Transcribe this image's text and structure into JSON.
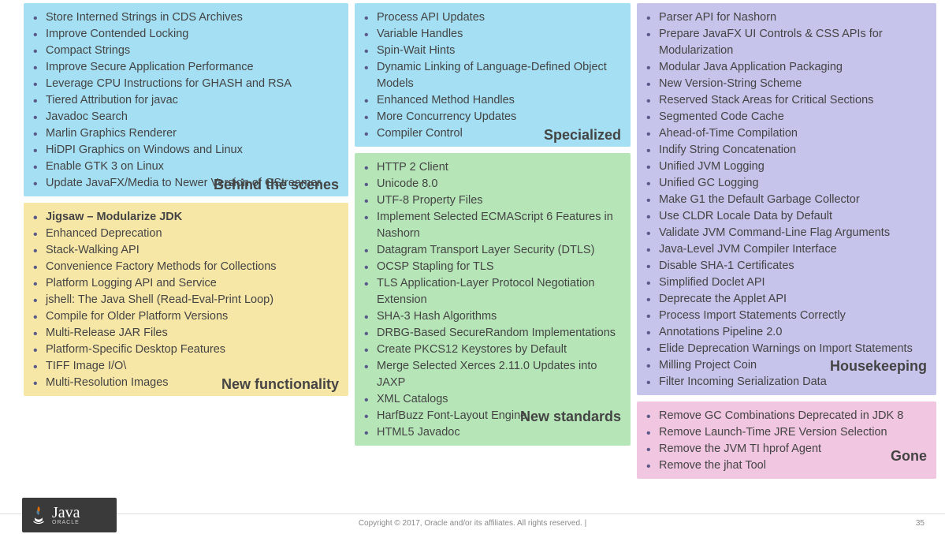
{
  "sections": {
    "behind_the_scenes": {
      "label": "Behind the scenes",
      "items": [
        "Store Interned Strings in CDS Archives",
        "Improve Contended Locking",
        "Compact Strings",
        "Improve Secure Application Performance",
        "Leverage CPU Instructions for GHASH and RSA",
        "Tiered Attribution for javac",
        "Javadoc Search",
        "Marlin Graphics Renderer",
        "HiDPI Graphics on Windows and Linux",
        "Enable GTK 3 on Linux",
        "Update JavaFX/Media to Newer Version of GStreamer"
      ]
    },
    "new_functionality": {
      "label": "New functionality",
      "items": [
        "Jigsaw – Modularize JDK",
        "Enhanced Deprecation",
        "Stack-Walking API",
        "Convenience Factory Methods for Collections",
        "Platform Logging API and Service",
        "jshell: The Java Shell (Read-Eval-Print Loop)",
        "Compile for Older Platform Versions",
        "Multi-Release JAR Files",
        "Platform-Specific Desktop Features",
        "TIFF Image I/O\\",
        "Multi-Resolution Images"
      ]
    },
    "specialized": {
      "label": "Specialized",
      "items": [
        "Process API Updates",
        "Variable Handles",
        "Spin-Wait Hints",
        "Dynamic Linking of Language-Defined Object Models",
        "Enhanced Method Handles",
        "More Concurrency Updates",
        "Compiler Control"
      ]
    },
    "new_standards": {
      "label": "New standards",
      "items": [
        "HTTP 2 Client",
        "Unicode 8.0",
        "UTF-8 Property Files",
        "Implement Selected ECMAScript 6 Features in Nashorn",
        "Datagram Transport Layer Security (DTLS)",
        "OCSP Stapling for TLS",
        "TLS Application-Layer Protocol Negotiation Extension",
        "SHA-3 Hash Algorithms",
        "DRBG-Based SecureRandom Implementations",
        "Create PKCS12 Keystores by Default",
        "Merge Selected Xerces 2.11.0 Updates into JAXP",
        "XML Catalogs",
        "HarfBuzz Font-Layout Engine",
        "HTML5 Javadoc"
      ]
    },
    "housekeeping": {
      "label": "Housekeeping",
      "items": [
        "Parser API for Nashorn",
        "Prepare JavaFX UI Controls & CSS APIs for Modularization",
        "Modular Java Application Packaging",
        "New Version-String Scheme",
        "Reserved Stack Areas for Critical Sections",
        "Segmented Code Cache",
        "Ahead-of-Time Compilation",
        "Indify String Concatenation",
        "Unified JVM Logging",
        "Unified GC Logging",
        "Make G1 the Default Garbage Collector",
        "Use CLDR Locale Data by Default",
        "Validate JVM Command-Line Flag Arguments",
        "Java-Level JVM Compiler Interface",
        "Disable SHA-1 Certificates",
        "Simplified Doclet API",
        "Deprecate the Applet API",
        "Process Import Statements Correctly",
        "Annotations Pipeline 2.0",
        "Elide Deprecation Warnings on Import Statements",
        "Milling Project Coin",
        "Filter Incoming Serialization Data"
      ]
    },
    "gone": {
      "label": "Gone",
      "items": [
        "Remove GC Combinations Deprecated in JDK 8",
        "Remove Launch-Time JRE Version Selection",
        "Remove the JVM TI hprof Agent",
        "Remove the jhat Tool"
      ]
    }
  },
  "logo": {
    "name": "Java",
    "sub": "ORACLE"
  },
  "footer": {
    "copyright": "Copyright © 2017, Oracle and/or its affiliates. All rights reserved.  |",
    "page": "35"
  }
}
